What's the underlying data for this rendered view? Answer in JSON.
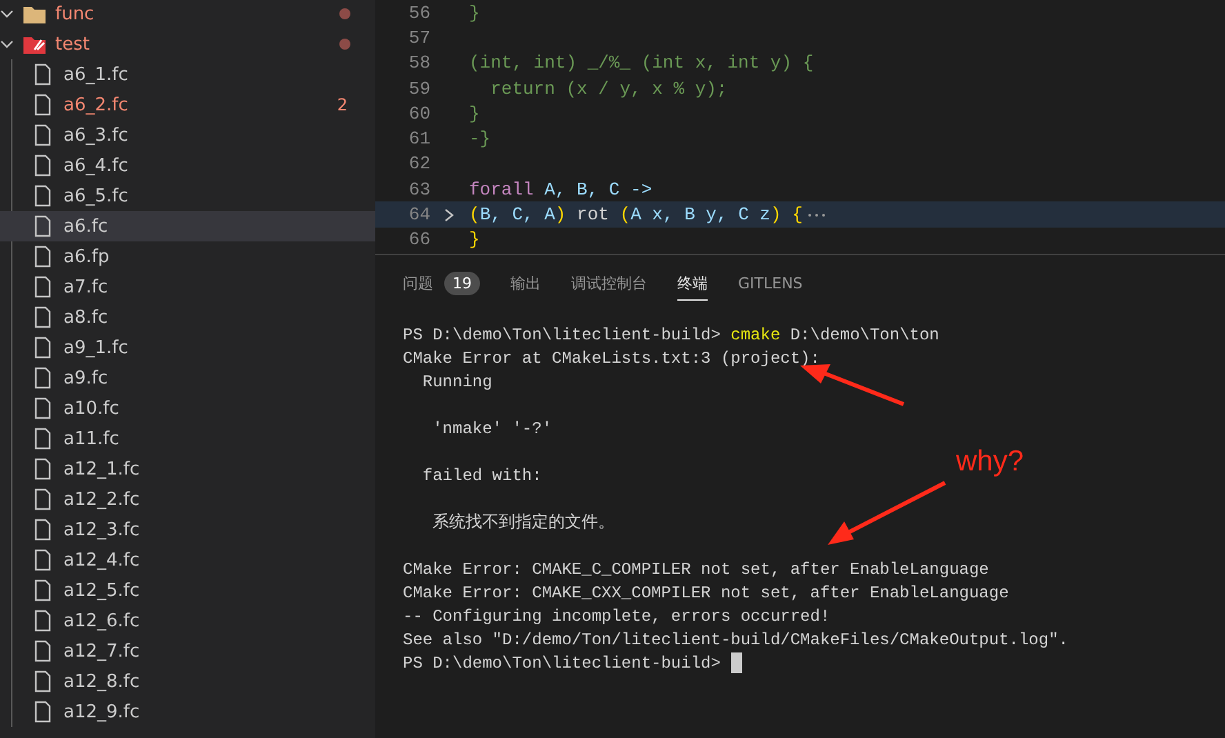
{
  "sidebar": {
    "tree": [
      {
        "name": "func",
        "kind": "folder",
        "expanded": true,
        "error": true,
        "modified": true,
        "selected": false
      },
      {
        "name": "test",
        "kind": "folder-test",
        "expanded": true,
        "error": true,
        "modified": true,
        "selected": false,
        "children": [
          {
            "name": "a6_1.fc",
            "kind": "file",
            "error": false,
            "selected": false
          },
          {
            "name": "a6_2.fc",
            "kind": "file",
            "error": true,
            "badge": "2",
            "selected": false
          },
          {
            "name": "a6_3.fc",
            "kind": "file",
            "error": false,
            "selected": false
          },
          {
            "name": "a6_4.fc",
            "kind": "file",
            "error": false,
            "selected": false
          },
          {
            "name": "a6_5.fc",
            "kind": "file",
            "error": false,
            "selected": false
          },
          {
            "name": "a6.fc",
            "kind": "file",
            "error": false,
            "selected": true
          },
          {
            "name": "a6.fp",
            "kind": "file",
            "error": false,
            "selected": false
          },
          {
            "name": "a7.fc",
            "kind": "file",
            "error": false,
            "selected": false
          },
          {
            "name": "a8.fc",
            "kind": "file",
            "error": false,
            "selected": false
          },
          {
            "name": "a9_1.fc",
            "kind": "file",
            "error": false,
            "selected": false
          },
          {
            "name": "a9.fc",
            "kind": "file",
            "error": false,
            "selected": false
          },
          {
            "name": "a10.fc",
            "kind": "file",
            "error": false,
            "selected": false
          },
          {
            "name": "a11.fc",
            "kind": "file",
            "error": false,
            "selected": false
          },
          {
            "name": "a12_1.fc",
            "kind": "file",
            "error": false,
            "selected": false
          },
          {
            "name": "a12_2.fc",
            "kind": "file",
            "error": false,
            "selected": false
          },
          {
            "name": "a12_3.fc",
            "kind": "file",
            "error": false,
            "selected": false
          },
          {
            "name": "a12_4.fc",
            "kind": "file",
            "error": false,
            "selected": false
          },
          {
            "name": "a12_5.fc",
            "kind": "file",
            "error": false,
            "selected": false
          },
          {
            "name": "a12_6.fc",
            "kind": "file",
            "error": false,
            "selected": false
          },
          {
            "name": "a12_7.fc",
            "kind": "file",
            "error": false,
            "selected": false
          },
          {
            "name": "a12_8.fc",
            "kind": "file",
            "error": false,
            "selected": false
          },
          {
            "name": "a12_9.fc",
            "kind": "file",
            "error": false,
            "selected": false
          }
        ]
      }
    ]
  },
  "editor": {
    "lines": [
      {
        "number": "56",
        "current": false,
        "folded": false,
        "tokens": [
          {
            "text": "}",
            "kind": "comment"
          }
        ]
      },
      {
        "number": "57",
        "current": false,
        "folded": false
      },
      {
        "number": "58",
        "current": false,
        "folded": false,
        "tokens": [
          {
            "text": "(int, int) _/%_ (int x, int y) {",
            "kind": "comment"
          }
        ]
      },
      {
        "number": "59",
        "current": false,
        "folded": false,
        "tokens": [
          {
            "text": "  return (x / y, x % y);",
            "kind": "comment"
          }
        ]
      },
      {
        "number": "60",
        "current": false,
        "folded": false,
        "tokens": [
          {
            "text": "}",
            "kind": "comment"
          }
        ]
      },
      {
        "number": "61",
        "current": false,
        "folded": false,
        "tokens": [
          {
            "text": "-}",
            "kind": "comment"
          }
        ]
      },
      {
        "number": "62",
        "current": false,
        "folded": false
      },
      {
        "number": "63",
        "current": false,
        "folded": false,
        "tokens": [
          {
            "text": "forall",
            "kind": "keyword"
          },
          {
            "text": " A, B, C ->",
            "kind": "type"
          }
        ]
      },
      {
        "number": "64",
        "current": true,
        "folded": true,
        "tokens": [
          {
            "text": "(",
            "kind": "bracket"
          },
          {
            "text": "B, C, A",
            "kind": "type"
          },
          {
            "text": ")",
            "kind": "bracket"
          },
          {
            "text": " rot ",
            "kind": "plain"
          },
          {
            "text": "(",
            "kind": "bracket"
          },
          {
            "text": "A x, B y, C z",
            "kind": "type"
          },
          {
            "text": ")",
            "kind": "bracket"
          },
          {
            "text": " {",
            "kind": "bracket"
          }
        ]
      },
      {
        "number": "66",
        "current": false,
        "folded": false,
        "tokens": [
          {
            "text": "}",
            "kind": "bracket"
          }
        ]
      }
    ]
  },
  "panel": {
    "tabs": [
      {
        "label": "问题",
        "badge": "19",
        "selected": false
      },
      {
        "label": "输出",
        "selected": false
      },
      {
        "label": "调试控制台",
        "selected": false
      },
      {
        "label": "终端",
        "selected": true
      },
      {
        "label": "GITLENS",
        "selected": false
      }
    ],
    "terminal": {
      "blocks": [
        [
          [
            {
              "text": "PS D:\\demo\\Ton\\liteclient-build> ",
              "kind": "plain"
            },
            {
              "text": "cmake",
              "kind": "command"
            },
            {
              "text": " D:\\demo\\Ton\\ton",
              "kind": "plain"
            }
          ],
          [
            {
              "text": "CMake Error at CMakeLists.txt:3 (project):",
              "kind": "plain"
            }
          ],
          [
            {
              "text": "  Running",
              "kind": "plain"
            }
          ]
        ],
        [
          [
            {
              "text": "   'nmake' '-?'",
              "kind": "plain"
            }
          ]
        ],
        [
          [
            {
              "text": "  failed with:",
              "kind": "plain"
            }
          ]
        ],
        [
          [
            {
              "text": "   系统找不到指定的文件。",
              "kind": "plain"
            }
          ]
        ],
        [
          [
            {
              "text": "CMake Error: CMAKE_C_COMPILER not set, after EnableLanguage",
              "kind": "plain"
            }
          ],
          [
            {
              "text": "CMake Error: CMAKE_CXX_COMPILER not set, after EnableLanguage",
              "kind": "plain"
            }
          ],
          [
            {
              "text": "-- Configuring incomplete, errors occurred!",
              "kind": "plain"
            }
          ],
          [
            {
              "text": "See also \"D:/demo/Ton/liteclient-build/CMakeFiles/CMakeOutput.log\".",
              "kind": "plain"
            }
          ],
          [
            {
              "text": "PS D:\\demo\\Ton\\liteclient-build> ",
              "kind": "plain"
            }
          ]
        ]
      ],
      "cursor": true
    }
  },
  "annotation": {
    "text": "why?"
  }
}
